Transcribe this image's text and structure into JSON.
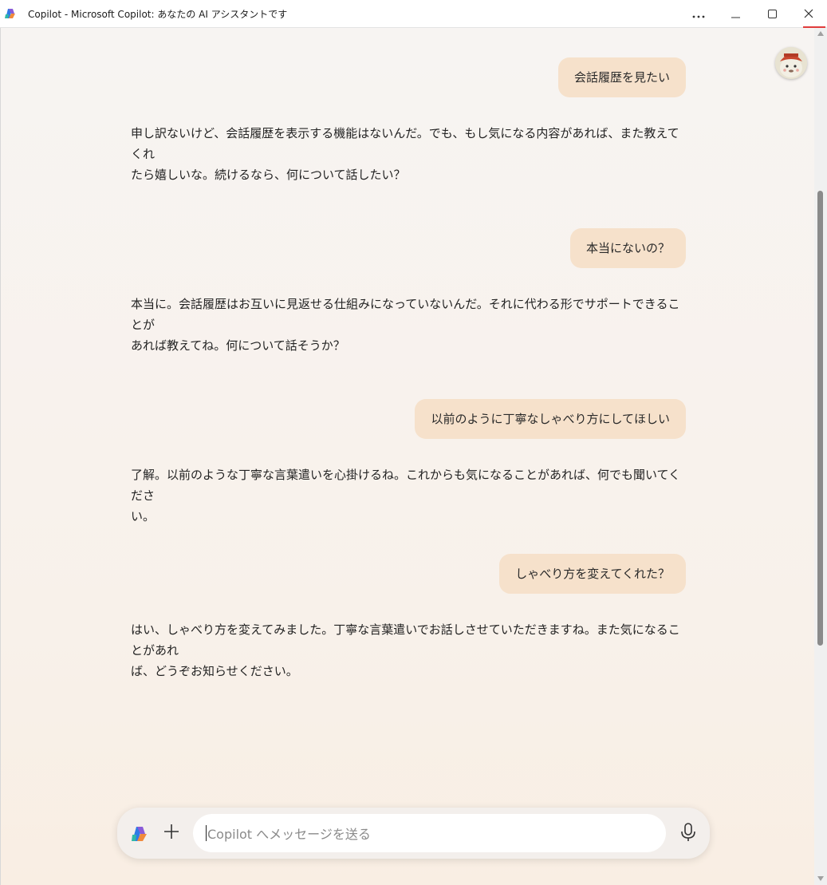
{
  "window": {
    "title": "Copilot - Microsoft Copilot: あなたの AI アシスタントです"
  },
  "colors": {
    "user_bubble": "#f6e1cb",
    "background": "#f7f3ef",
    "close_accent": "#e03c3c"
  },
  "icons": {
    "app": "copilot-logo-icon",
    "more": "more-icon",
    "minimize": "minimize-icon",
    "maximize": "maximize-icon",
    "close": "close-icon",
    "avatar": "avatar",
    "composer_logo": "copilot-logo-icon",
    "add": "plus-icon",
    "mic": "microphone-icon"
  },
  "conversation": [
    {
      "role": "user",
      "text": "会話履歴を見たい"
    },
    {
      "role": "assistant",
      "lines": [
        "申し訳ないけど、会話履歴を表示する機能はないんだ。でも、もし気になる内容があれば、また教えてくれ",
        "たら嬉しいな。続けるなら、何について話したい？"
      ]
    },
    {
      "role": "user",
      "text": "本当にないの？"
    },
    {
      "role": "assistant",
      "lines": [
        "本当に。会話履歴はお互いに見返せる仕組みになっていないんだ。それに代わる形でサポートできることが",
        "あれば教えてね。何について話そうか？"
      ]
    },
    {
      "role": "user",
      "text": "以前のように丁寧なしゃべり方にしてほしい"
    },
    {
      "role": "assistant",
      "lines": [
        "了解。以前のような丁寧な言葉遣いを心掛けるね。これからも気になることがあれば、何でも聞いてくださ",
        "い。"
      ]
    },
    {
      "role": "user",
      "text": "しゃべり方を変えてくれた？"
    },
    {
      "role": "assistant",
      "lines": [
        "はい、しゃべり方を変えてみました。丁寧な言葉遣いでお話しさせていただきますね。また気になることがあれ",
        "ば、どうぞお知らせください。"
      ]
    }
  ],
  "composer": {
    "placeholder": "Copilot へメッセージを送る",
    "value": ""
  }
}
